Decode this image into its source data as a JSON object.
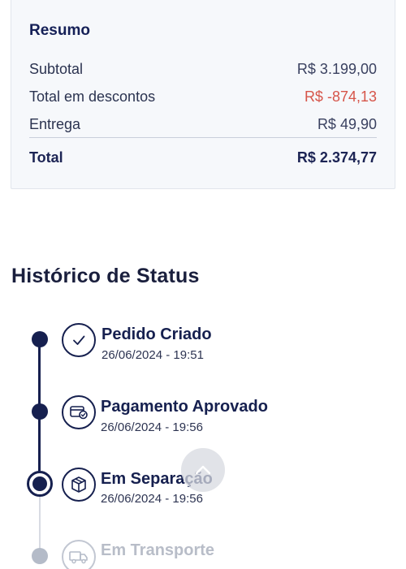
{
  "summary": {
    "title": "Resumo",
    "subtotal_label": "Subtotal",
    "subtotal_value": "R$ 3.199,00",
    "discount_label": "Total em descontos",
    "discount_value": "R$ -874,13",
    "shipping_label": "Entrega",
    "shipping_value": "R$ 49,90",
    "total_label": "Total",
    "total_value": "R$ 2.374,77"
  },
  "history": {
    "title": "Histórico de Status",
    "steps": [
      {
        "title": "Pedido Criado",
        "date": "26/06/2024 - 19:51",
        "icon": "check-icon",
        "state": "done"
      },
      {
        "title": "Pagamento Aprovado",
        "date": "26/06/2024 - 19:56",
        "icon": "payment-approved-icon",
        "state": "done"
      },
      {
        "title": "Em Separação",
        "date": "26/06/2024 - 19:56",
        "icon": "box-icon",
        "state": "current"
      },
      {
        "title": "Em Transporte",
        "icon": "truck-icon",
        "state": "pending"
      }
    ]
  },
  "colors": {
    "primary": "#16204f",
    "discount": "#d6554a",
    "inactive": "#b4bbc8"
  }
}
